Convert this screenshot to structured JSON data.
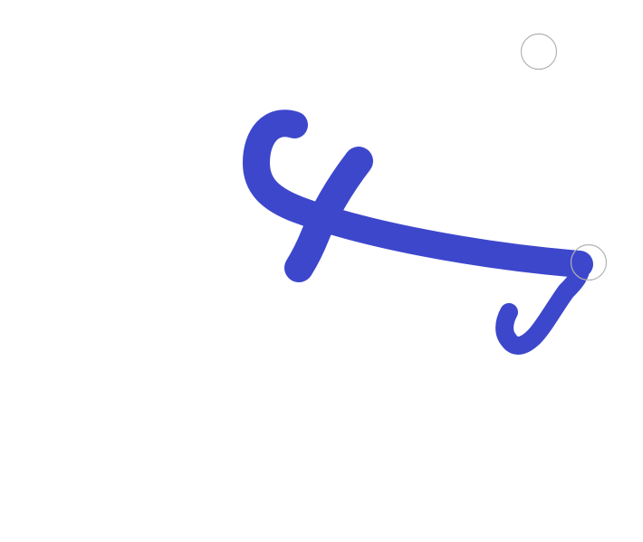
{
  "canvas": {
    "background_color": "#ffffff"
  },
  "strokes": [
    {
      "id": "stroke-1",
      "color": "#3d47cc"
    },
    {
      "id": "stroke-2",
      "color": "#3d47cc"
    },
    {
      "id": "stroke-3",
      "color": "#3d47cc"
    }
  ],
  "handles": [
    {
      "id": "handle-1",
      "color": "#b3b3b3"
    },
    {
      "id": "handle-2",
      "color": "#b3b3b3"
    }
  ]
}
